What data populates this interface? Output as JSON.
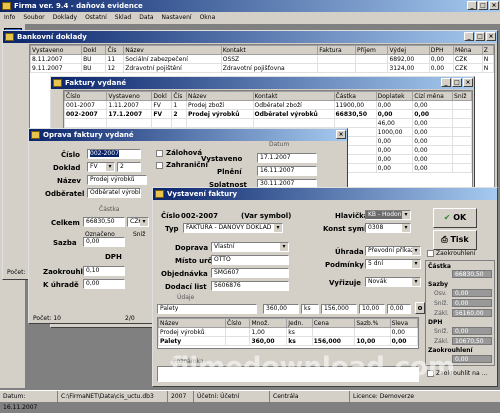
{
  "app": {
    "title": "Firma ver. 9.4 - daňová evidence",
    "menu": [
      "Info",
      "Soubor",
      "Doklady",
      "Ostatní",
      "Sklad",
      "Data",
      "Nastavení",
      "Okna"
    ],
    "status": [
      "Datum: 16.11.2007",
      "C:\\FirmaNET\\Data\\cis_uctu.db3",
      "2007",
      "Účetní: Účetní",
      "Centrála",
      "Licence: Demoverze"
    ]
  },
  "watermark": "filmedownload.com",
  "bank": {
    "title": "Bankovní doklady",
    "columns": [
      "Vystaveno",
      "Dokl",
      "Čís",
      "Název",
      "Kontakt",
      "Faktura",
      "Příjem",
      "Výdej",
      "DPH",
      "Měna",
      "Z"
    ],
    "rows": [
      [
        "8.11.2007",
        "BU",
        "11",
        "Sociální zabezpečení",
        "OSSZ",
        "",
        "",
        "6892,00",
        "0,00",
        "CZK",
        "N"
      ],
      [
        "9.11.2007",
        "BU",
        "12",
        "Zdravotní pojištění",
        "Zdravotní pojišťovna",
        "",
        "",
        "3124,00",
        "0,00",
        "CZK",
        "N"
      ]
    ]
  },
  "invoices": {
    "title": "Faktury vydané",
    "columns": [
      "Číslo",
      "Vystaveno",
      "Dokl",
      "Čís",
      "Název",
      "Kontakt",
      "Částka",
      "Doplatek",
      "Cizí měna",
      "Sníž"
    ],
    "rows": [
      [
        "001-2007",
        "1.11.2007",
        "FV",
        "1",
        "Prodej zboží",
        "Odběratel zboží",
        "11900,00",
        "0,00",
        "0,00",
        ""
      ],
      [
        "002-2007",
        "17.1.2007",
        "FV",
        "2",
        "Prodej výrobků",
        "Odběratel výrobků",
        "66830,50",
        "0,00",
        "0,00",
        ""
      ],
      [
        "",
        "",
        "",
        "",
        "",
        "",
        "",
        "46,00",
        "0,00",
        ""
      ],
      [
        "",
        "",
        "",
        "",
        "",
        "",
        "",
        "1000,00",
        "0,00",
        ""
      ],
      [
        "",
        "",
        "",
        "",
        "",
        "",
        "",
        "0,00",
        "0,00",
        ""
      ],
      [
        "",
        "",
        "",
        "",
        "",
        "",
        "",
        "0,00",
        "0,00",
        ""
      ],
      [
        "",
        "",
        "",
        "",
        "",
        "",
        "",
        "0,00",
        "0,00",
        ""
      ],
      [
        "",
        "",
        "",
        "",
        "",
        "",
        "",
        "0,00",
        "0,00",
        ""
      ]
    ],
    "count_label": "Počet: 10",
    "page": "2/0"
  },
  "edit": {
    "title": "Oprava faktury vydané",
    "cislo_label": "Číslo",
    "cislo": "002-2007",
    "doklad_label": "Doklad",
    "doklad": "FV",
    "doklad_num": "2",
    "nazev_label": "Název",
    "nazev": "Prodej výrobků",
    "odberatel_label": "Odběratel",
    "odberatel": "Odběratel výrobků",
    "zalohova": "Zálohová",
    "zahranicni": "Zahraniční",
    "datum_label": "Datum",
    "vystaveno_label": "Vystaveno",
    "vystaveno": "17.1.2007",
    "plneni_label": "Plnění",
    "plneni": "16.11.2007",
    "splatnost_label": "Splatnost",
    "splatnost": "30.11.2007",
    "castka_group": "Částka",
    "celkem_label": "Celkem",
    "celkem": "66830,50",
    "mena": "CZK",
    "oznaceno": "Označeno",
    "snizeni": "Sníž",
    "sazba_label": "Sazba",
    "sazba": "0,00",
    "dph_label": "DPH",
    "zaokrouhlit_label": "Zaokrouhl",
    "zaokrouhlit": "0,10",
    "kuhrade_label": "K úhradě",
    "kuhrade": "0,00",
    "count": "Počet: 10",
    "page": "2/0"
  },
  "issue": {
    "title": "Vystavení faktury",
    "cislo_label": "Číslo",
    "cislo": "002-2007",
    "var_symbol": "(Var symbol)",
    "typ_label": "Typ",
    "typ": "FAKTURA - DAŇOVÝ DOKLAD",
    "hlavicka_label": "Hlavička",
    "hlavicka": "KB - Hodonín",
    "konst_label": "Konst symbol",
    "konst": "0308",
    "doprava_label": "Doprava",
    "doprava": "Vlastní",
    "misto_label": "Místo urč.",
    "misto": "OTTO",
    "objednavka_label": "Objednávka",
    "objednavka": "SMG607",
    "dodaci_label": "Dodací list",
    "dodaci": "5606876",
    "uhrada_label": "Úhrada",
    "uhrada": "Převodní příkaz",
    "podminky_label": "Podmínky",
    "podminky": "5 dní",
    "vyuzuje_label": "Vyřizuje",
    "vyuzuje": "Novák",
    "ok": "OK",
    "tisk": "Tisk",
    "zaokrouhleni": "Zaokrouhlení",
    "udaje_label": "Údaje",
    "entry": [
      "Palety",
      "",
      "360,00",
      "ks",
      "156,000",
      "10,00",
      "0,00"
    ],
    "item_columns": [
      "Název",
      "Číslo",
      "Množ.",
      "Jedn.",
      "Cena",
      "Sazb.%",
      "Sleva"
    ],
    "items": [
      [
        "Prodej výrobků",
        "",
        "1,00",
        "ks",
        "",
        "",
        "0,00"
      ],
      [
        "Palety",
        "",
        "360,00",
        "ks",
        "156,000",
        "10,00",
        "0,00"
      ]
    ],
    "poznamka": "Poznámka",
    "side": {
      "castka": "Částka",
      "castka_val": "66830,50",
      "sazby": "Sazby",
      "osv": "Osv.",
      "osv_val": "0,00",
      "snizena": "Sníž.",
      "snizena_val": "0,00",
      "zakl": "Zákl.",
      "zakl_val": "56160,00",
      "dph": "DPH",
      "dph_snizena": "Sníž.",
      "dph_snizena_val": "0,00",
      "dph_zakl": "Zákl.",
      "dph_zakl_val": "10670,50",
      "zaokrouhleni": "Zaokrouhlení",
      "zaok_val": "0,00",
      "zaokrouhlit_cb": "Zaokrouhlit na ..."
    }
  }
}
